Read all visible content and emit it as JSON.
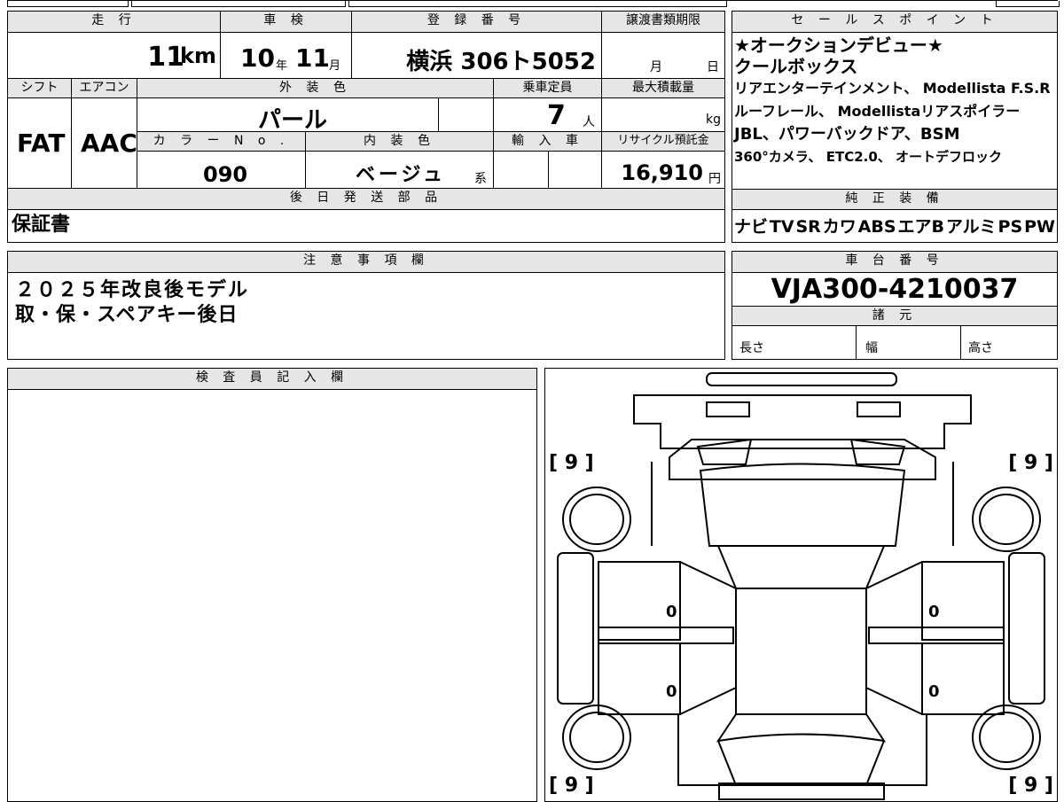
{
  "labels": {
    "mileage": "走 行",
    "inspection": "車 検",
    "registration": "登 録 番 号",
    "transfer_deadline": "譲渡書類期限",
    "sales_points": "セ ー ル ス ポ イ ン ト",
    "shift": "シフト",
    "aircon": "エアコン",
    "exterior_color": "外 装 色",
    "capacity": "乗車定員",
    "max_load": "最大積載量",
    "color_no": "カ ラ ー N o .",
    "interior_color": "内 装 色",
    "import": "輸 入 車",
    "recycle": "リサイクル預託金",
    "later_parts": "後 日 発 送 部 品",
    "genuine_equipment": "純 正 装 備",
    "notes": "注 意 事 項 欄",
    "chassis_no": "車 台 番 号",
    "specs": "諸 元",
    "length": "長さ",
    "width": "幅",
    "height": "高さ",
    "inspector": "検 査 員 記 入 欄"
  },
  "values": {
    "mileage_num": "11",
    "mileage_unit": "km",
    "insp_year": "10",
    "insp_year_unit": "年",
    "insp_month": "11",
    "insp_month_unit": "月",
    "registration": "横浜 306ト5052",
    "deadline_month": "月",
    "deadline_day": "日",
    "shift": "FAT",
    "aircon": "AAC",
    "exterior_color": "パール",
    "capacity": "7",
    "capacity_unit": "人",
    "load_unit": "kg",
    "color_no": "090",
    "interior_color": "ベージュ",
    "interior_suffix": "系",
    "recycle_amount": "16,910",
    "recycle_unit": "円",
    "later_parts": "保証書",
    "chassis_no": "VJA300-4210037"
  },
  "sales_points": [
    "★オークションデビュー★",
    "クールボックス",
    "リアエンターテインメント、 Modellista F.S.R",
    "ルーフレール、 Modellistaリアスポイラー",
    "JBL、パワーバックドア、BSM",
    "360°カメラ、 ETC2.0、 オートデフロック"
  ],
  "equipment": [
    "ナビ",
    "TV",
    "SR",
    "カワ",
    "ABS",
    "エアB",
    "アルミ",
    "PS",
    "PW"
  ],
  "notes": [
    "２０２５年改良後モデル",
    "取・保・スペアキー後日"
  ],
  "diagram": {
    "corner_tl": "[ 9 ]",
    "corner_tr": "[ 9 ]",
    "corner_bl": "[ 9 ]",
    "corner_br": "[ 9 ]",
    "door_fl": "0",
    "door_fr": "0",
    "door_rl": "0",
    "door_rr": "0"
  }
}
